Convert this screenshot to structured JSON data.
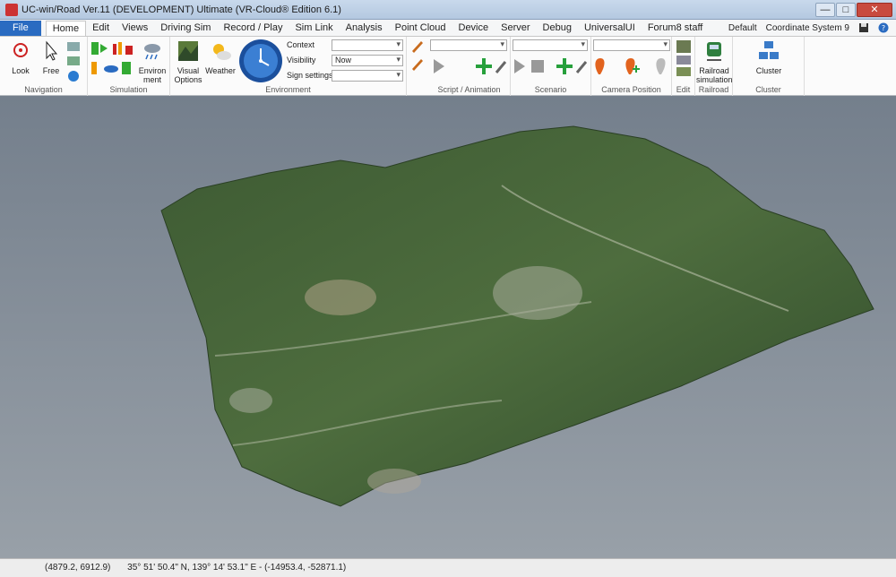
{
  "window": {
    "title": "UC-win/Road Ver.11 (DEVELOPMENT) Ultimate (VR-Cloud® Edition 6.1)",
    "minimize": "—",
    "maximize": "□",
    "close": "✕"
  },
  "menu": [
    "File",
    "Home",
    "Edit",
    "Views",
    "Driving Sim",
    "Record / Play",
    "Sim Link",
    "Analysis",
    "Point Cloud",
    "Device",
    "Server",
    "Debug",
    "UniversalUI",
    "Forum8 staff"
  ],
  "right": {
    "profile": "Default",
    "coordinate_system": "Coordinate System 9"
  },
  "ribbon": {
    "navigation": {
      "label": "Navigation",
      "look": "Look",
      "free": "Free"
    },
    "simulation": {
      "label": "Simulation",
      "environment": "Environ ment"
    },
    "environment": {
      "label": "Environment",
      "visual_options": "Visual Options",
      "weather": "Weather",
      "context_label": "Context",
      "visibility_label": "Visibility",
      "visibility_value": "Now",
      "sign_settings_label": "Sign settings"
    },
    "script_animation": {
      "label": "Script / Animation"
    },
    "scenario": {
      "label": "Scenario"
    },
    "camera_position": {
      "label": "Camera Position"
    },
    "edit": {
      "label": "Edit"
    },
    "railroad": {
      "label": "Railroad",
      "railroad_sim": "Railroad simulation"
    },
    "cluster": {
      "label": "Cluster",
      "cluster": "Cluster"
    }
  },
  "status": {
    "screen_coords": "(4879.2, 6912.9)",
    "geo_coords": "35° 51' 50.4\" N, 139° 14' 53.1\" E - (-14953.4, -52871.1)"
  },
  "colors": {
    "file_tab": "#2a6bc1",
    "terrain_dark": "#2f4a2a",
    "terrain_light": "#6f8a5e",
    "sky": "#7f8a96"
  }
}
